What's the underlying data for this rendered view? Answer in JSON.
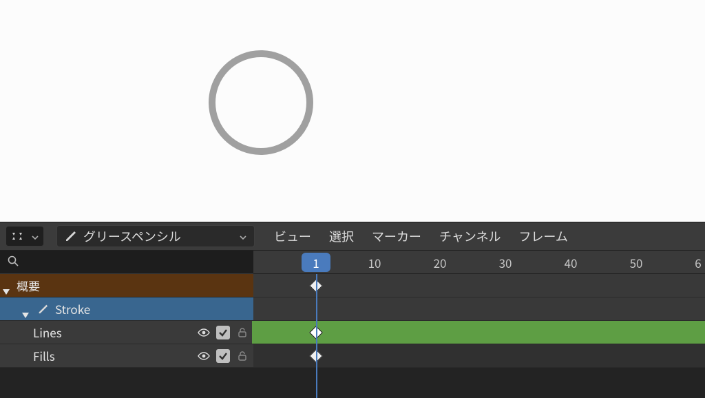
{
  "viewport": {
    "stroke_color": "#a0a0a0"
  },
  "dopesheet": {
    "mode_label": "グリースペンシル",
    "menu": {
      "view": "ビュー",
      "select": "選択",
      "marker": "マーカー",
      "channel": "チャンネル",
      "frame": "フレーム"
    },
    "search_placeholder": "",
    "ruler": {
      "current": "1",
      "ticks": [
        "10",
        "20",
        "30",
        "40",
        "50",
        "6"
      ]
    },
    "channels": {
      "summary_label": "概要",
      "object_label": "Stroke",
      "layers": [
        {
          "name": "Lines",
          "visible": true,
          "use": true,
          "locked": false,
          "has_key_at_current": true,
          "active": true
        },
        {
          "name": "Fills",
          "visible": true,
          "use": true,
          "locked": false,
          "has_key_at_current": true,
          "active": false
        }
      ]
    },
    "keyframe_frame": 1
  },
  "colors": {
    "summary_row": "#5a3411",
    "object_row": "#39668f",
    "track_green": "#5e9e44",
    "playhead": "#4a7bbd"
  }
}
